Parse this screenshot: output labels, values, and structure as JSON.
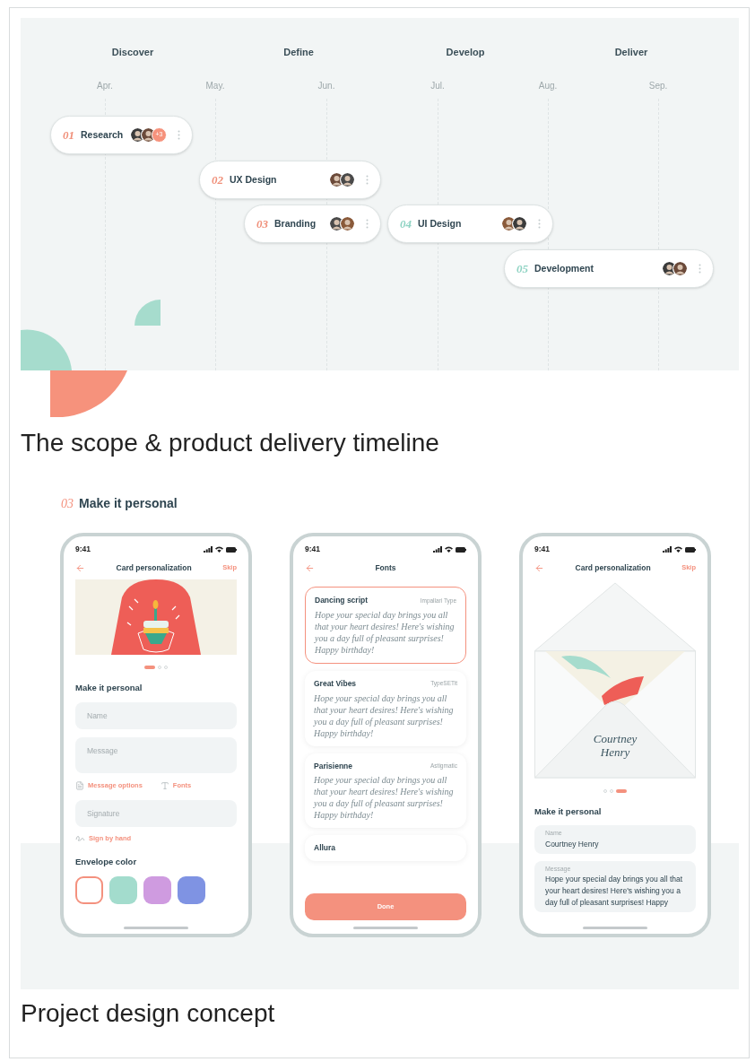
{
  "timeline": {
    "phases": [
      "Discover",
      "Define",
      "Develop",
      "Deliver"
    ],
    "months": [
      "Apr.",
      "May.",
      "Jun.",
      "Jul.",
      "Aug.",
      "Sep."
    ],
    "tasks": [
      {
        "number": "01",
        "name": "Research",
        "color": "#f0907a",
        "extra": "+3"
      },
      {
        "number": "02",
        "name": "UX Design",
        "color": "#f0907a"
      },
      {
        "number": "03",
        "name": "Branding",
        "color": "#f0907a"
      },
      {
        "number": "04",
        "name": "UI Design",
        "color": "#8fd3c3"
      },
      {
        "number": "05",
        "name": "Development",
        "color": "#8fd3c3"
      }
    ]
  },
  "caption_1": "The scope & product delivery timeline",
  "concept": {
    "number": "03",
    "title": "Make it personal",
    "phones": [
      {
        "kind": "form",
        "time": "9:41",
        "title": "Card personalization",
        "action": "Skip",
        "dots": [
          {
            "selected": true
          },
          {
            "selected": false
          },
          {
            "selected": false
          }
        ],
        "section": "Make it personal",
        "fields": [
          {
            "kind": "line",
            "placeholder": "Name"
          },
          {
            "kind": "area",
            "placeholder": "Message"
          }
        ],
        "options": [
          "Message options",
          "Fonts"
        ],
        "signature": {
          "placeholder": "Signature"
        },
        "sign_link": "Sign by hand",
        "envelope_title": "Envelope color",
        "swatches": [
          {
            "color": "#ffffff",
            "selected": true
          },
          {
            "color": "#a3dccd",
            "selected": false
          },
          {
            "color": "#cf9be0",
            "selected": false
          },
          {
            "color": "#7f93e3",
            "selected": false
          }
        ]
      },
      {
        "kind": "fonts",
        "time": "9:41",
        "title": "Fonts",
        "fonts": [
          {
            "name": "Dancing script",
            "source": "Impallari Type",
            "sample": "Hope your special day brings you all that your heart desires! Here's wishing you a day full of pleasant surprises! Happy birthday!",
            "selected": true
          },
          {
            "name": "Great Vibes",
            "source": "TypeSETit",
            "sample": "Hope your special day brings you all that your heart desires! Here's wishing you a day full of pleasant surprises! Happy birthday!",
            "selected": false
          },
          {
            "name": "Parisienne",
            "source": "Astigmatic",
            "sample": "Hope your special day brings you all that your heart desires! Here's wishing you a day full of pleasant surprises! Happy birthday!",
            "selected": false
          },
          {
            "name": "Allura",
            "selected": false
          }
        ],
        "button": "Done"
      },
      {
        "kind": "preview",
        "time": "9:41",
        "title": "Card personalization",
        "action": "Skip",
        "envelope_name": "Courtney Henry",
        "dots": [
          {
            "selected": false
          },
          {
            "selected": false
          },
          {
            "selected": true
          }
        ],
        "section": "Make it personal",
        "fields": [
          {
            "label": "Name",
            "value": "Courtney Henry"
          },
          {
            "label": "Message",
            "value": "Hope your special day brings you all that your heart desires! Here's wishing you a day full of pleasant surprises! Happy"
          }
        ]
      }
    ]
  },
  "caption_2": "Project design concept"
}
